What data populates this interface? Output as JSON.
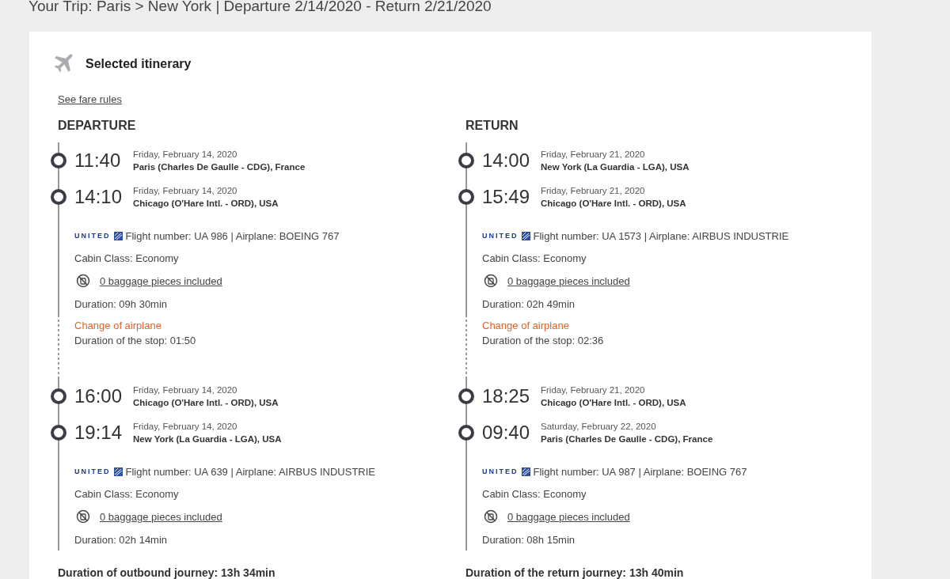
{
  "trip_summary": "Your Trip: Paris > New York | Departure 2/14/2020 - Return 2/21/2020",
  "card": {
    "title": "Selected itinerary",
    "fare_rules_link": "See fare rules",
    "columns": [
      {
        "heading": "DEPARTURE",
        "segments": [
          {
            "kind": "leg",
            "departure": {
              "time": "11:40",
              "date": "Friday, February 14, 2020",
              "place": "Paris (Charles De Gaulle - CDG), France"
            },
            "arrival": {
              "time": "14:10",
              "date": "Friday, February 14, 2020",
              "place": "Chicago (O'Hare Intl. - ORD), USA"
            },
            "airline": "UNITED",
            "flight": "Flight number: UA 986 | Airplane: BOEING 767",
            "cabin": "Cabin Class: Economy",
            "baggage": "0 baggage pieces included",
            "duration": "Duration: 09h 30min"
          },
          {
            "kind": "stop",
            "label": "Change of airplane",
            "duration": "Duration of the stop: 01:50"
          },
          {
            "kind": "leg",
            "departure": {
              "time": "16:00",
              "date": "Friday, February 14, 2020",
              "place": "Chicago (O'Hare Intl. - ORD), USA"
            },
            "arrival": {
              "time": "19:14",
              "date": "Friday, February 14, 2020",
              "place": "New York (La Guardia - LGA), USA"
            },
            "airline": "UNITED",
            "flight": "Flight number: UA 639 | Airplane: AIRBUS INDUSTRIE",
            "cabin": "Cabin Class: Economy",
            "baggage": "0 baggage pieces included",
            "duration": "Duration: 02h 14min"
          }
        ],
        "total": "Duration of outbound journey: 13h 34min"
      },
      {
        "heading": "RETURN",
        "segments": [
          {
            "kind": "leg",
            "departure": {
              "time": "14:00",
              "date": "Friday, February 21, 2020",
              "place": "New York (La Guardia - LGA), USA"
            },
            "arrival": {
              "time": "15:49",
              "date": "Friday, February 21, 2020",
              "place": "Chicago (O'Hare Intl. - ORD), USA"
            },
            "airline": "UNITED",
            "flight": "Flight number: UA 1573 | Airplane: AIRBUS INDUSTRIE",
            "cabin": "Cabin Class: Economy",
            "baggage": "0 baggage pieces included",
            "duration": "Duration: 02h 49min"
          },
          {
            "kind": "stop",
            "label": "Change of airplane",
            "duration": "Duration of the stop: 02:36"
          },
          {
            "kind": "leg",
            "departure": {
              "time": "18:25",
              "date": "Friday, February 21, 2020",
              "place": "Chicago (O'Hare Intl. - ORD), USA"
            },
            "arrival": {
              "time": "09:40",
              "date": "Saturday, February 22, 2020",
              "place": "Paris (Charles De Gaulle - CDG), France"
            },
            "airline": "UNITED",
            "flight": "Flight number: UA 987 | Airplane: BOEING 767",
            "cabin": "Cabin Class: Economy",
            "baggage": "0 baggage pieces included",
            "duration": "Duration: 08h 15min"
          }
        ],
        "total": "Duration of the return journey: 13h 40min"
      }
    ]
  }
}
